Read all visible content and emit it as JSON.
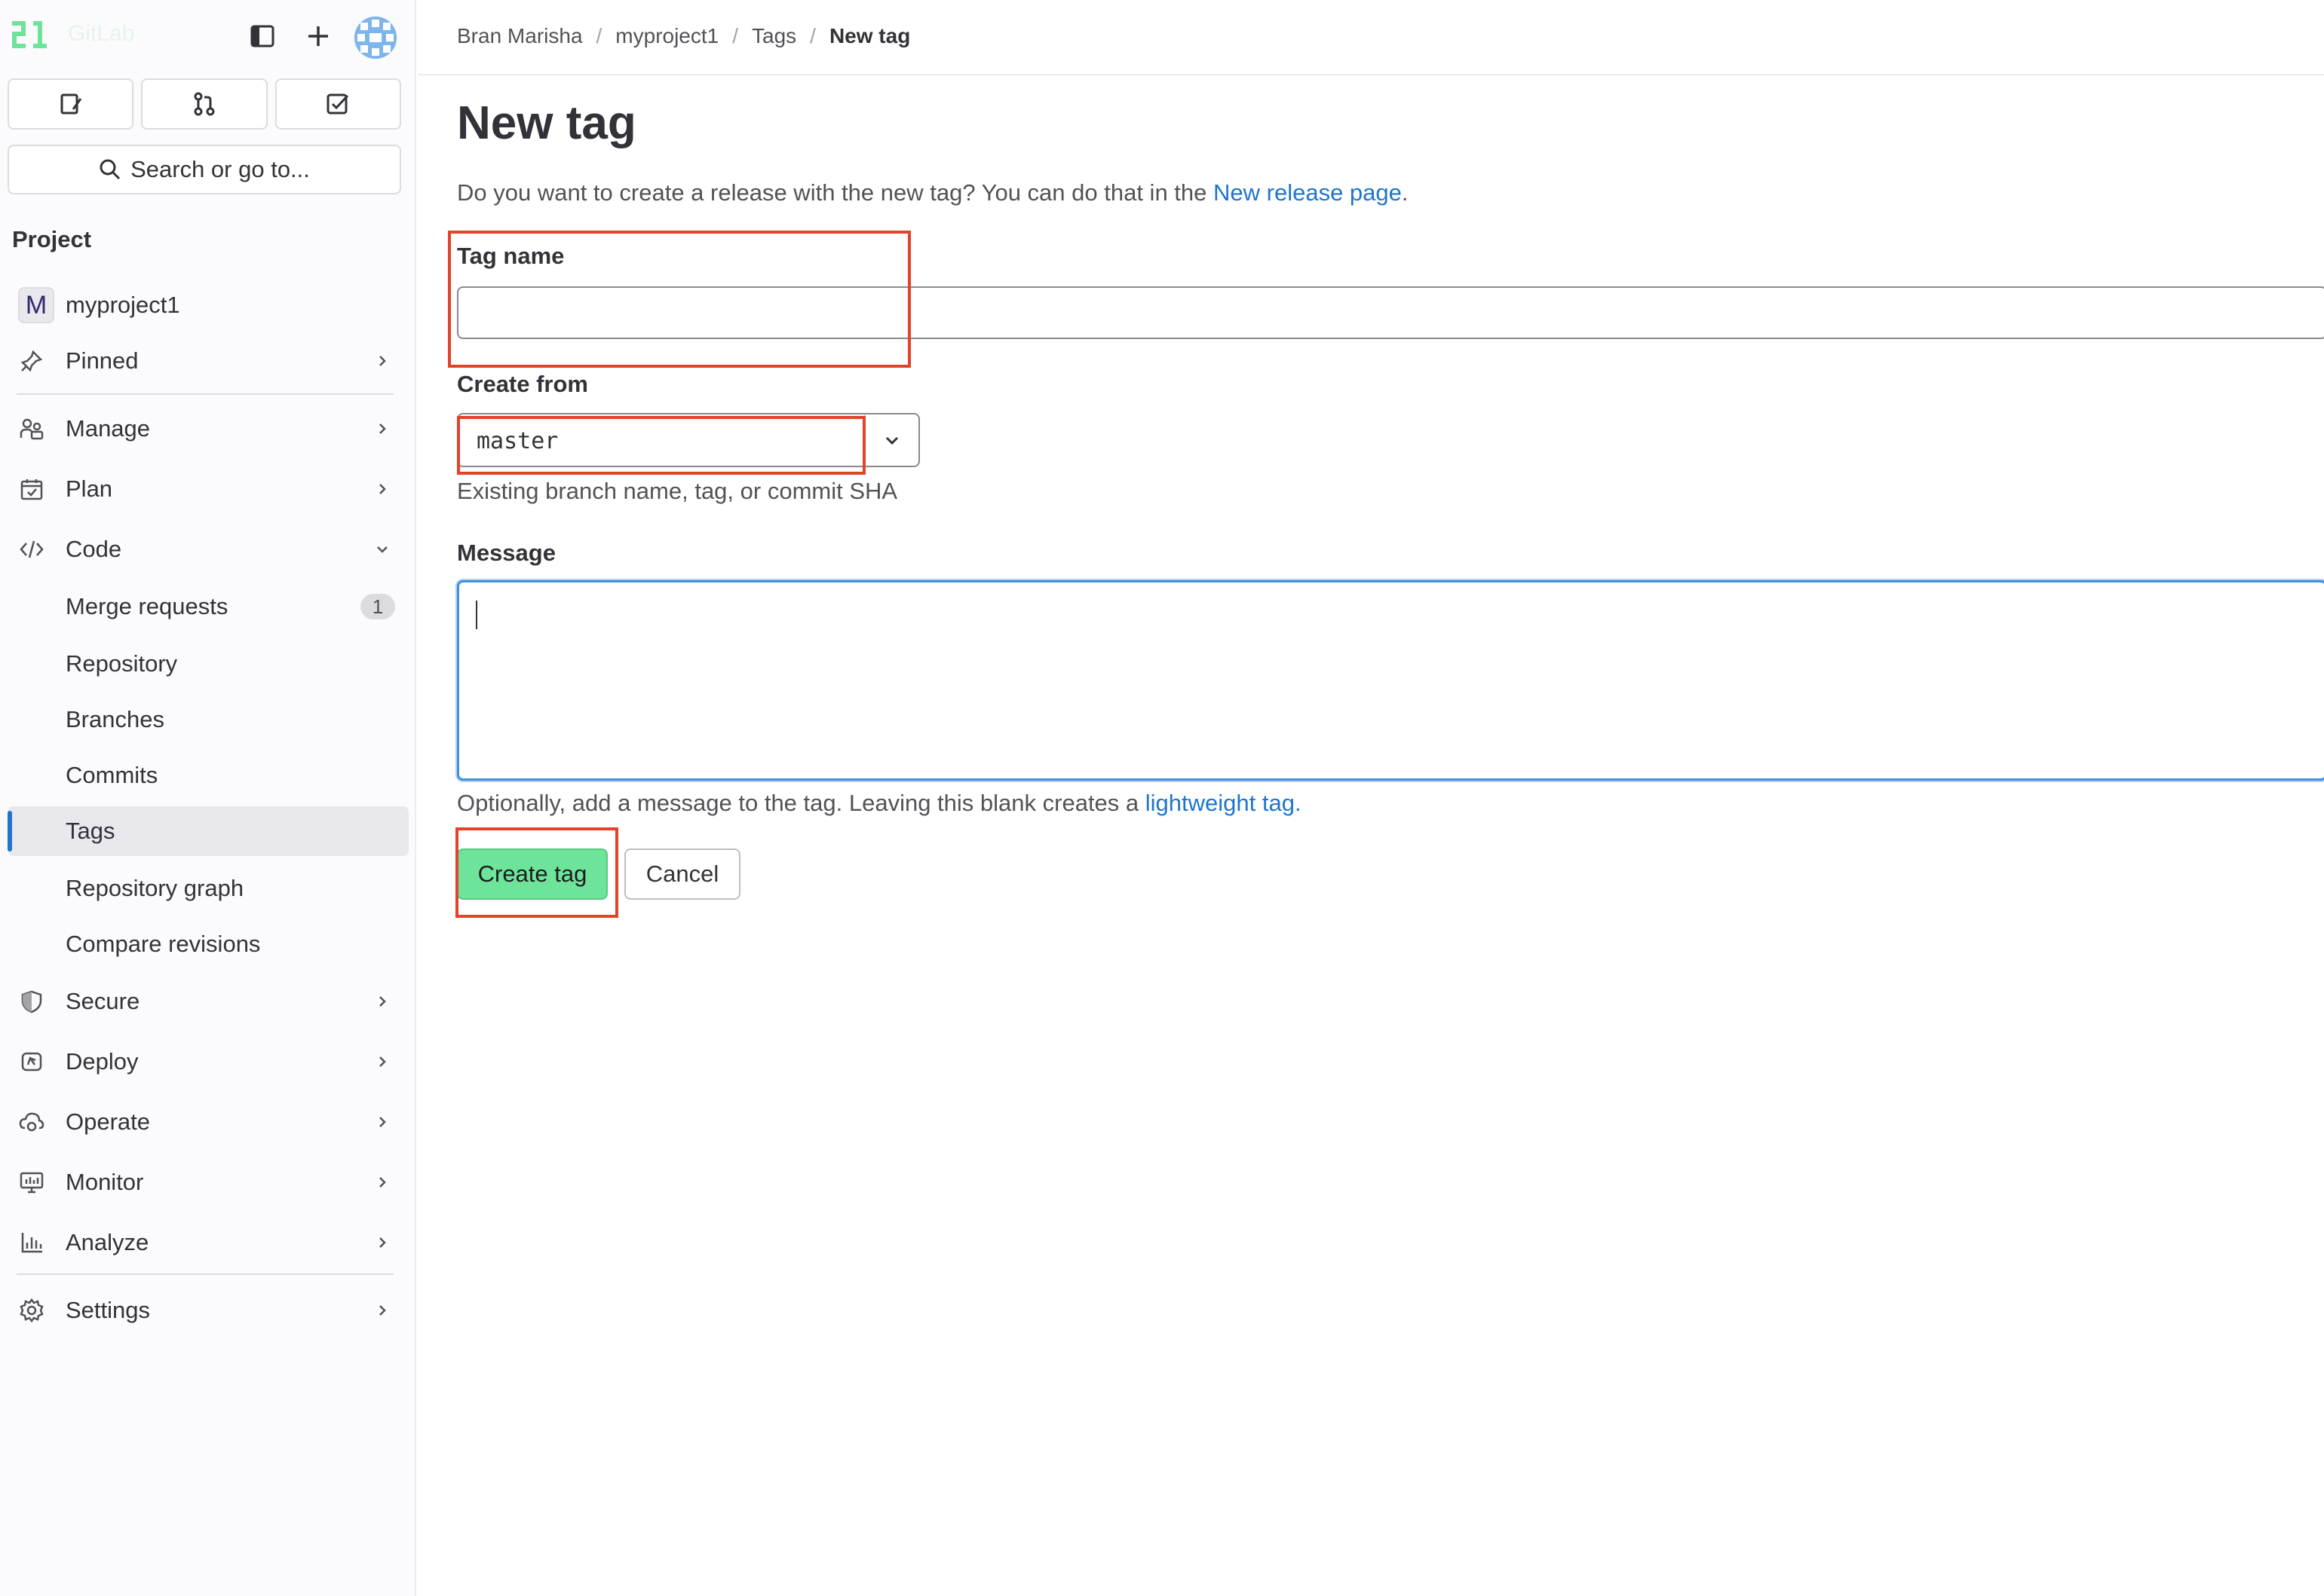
{
  "app": {
    "logo_text": "GitLab",
    "accent_color": "#6ee49b",
    "link_color": "#1f75cb",
    "highlight_color": "#e24329"
  },
  "sidebar": {
    "search_label": "Search or go to...",
    "section_title": "Project",
    "project": {
      "letter": "M",
      "name": "myproject1"
    },
    "items": [
      {
        "label": "Pinned",
        "icon": "pin-icon"
      },
      {
        "label": "Manage",
        "icon": "users-icon"
      },
      {
        "label": "Plan",
        "icon": "calendar-icon"
      },
      {
        "label": "Code",
        "icon": "code-icon",
        "expanded": true
      },
      {
        "label": "Secure",
        "icon": "shield-icon"
      },
      {
        "label": "Deploy",
        "icon": "deploy-icon"
      },
      {
        "label": "Operate",
        "icon": "cloud-gear-icon"
      },
      {
        "label": "Monitor",
        "icon": "monitor-icon"
      },
      {
        "label": "Analyze",
        "icon": "chart-icon"
      },
      {
        "label": "Settings",
        "icon": "gear-icon"
      }
    ],
    "code_subitems": [
      {
        "label": "Merge requests",
        "badge": "1"
      },
      {
        "label": "Repository"
      },
      {
        "label": "Branches"
      },
      {
        "label": "Commits"
      },
      {
        "label": "Tags",
        "active": true
      },
      {
        "label": "Repository graph"
      },
      {
        "label": "Compare revisions"
      }
    ]
  },
  "breadcrumb": [
    "Bran Marisha",
    "myproject1",
    "Tags",
    "New tag"
  ],
  "page": {
    "title": "New tag",
    "intro_text": "Do you want to create a release with the new tag? You can do that in the ",
    "intro_link": "New release page",
    "intro_end": ".",
    "tag_name_label": "Tag name",
    "tag_name_value": "",
    "create_from_label": "Create from",
    "create_from_value": "master",
    "create_from_help": "Existing branch name, tag, or commit SHA",
    "message_label": "Message",
    "message_value": "",
    "message_help": "Optionally, add a message to the tag. Leaving this blank creates a ",
    "message_help_link": "lightweight tag.",
    "create_button": "Create tag",
    "cancel_button": "Cancel"
  }
}
